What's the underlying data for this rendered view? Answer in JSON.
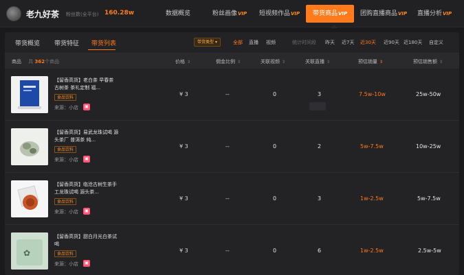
{
  "header": {
    "shop_name": "老九好茶",
    "fans_label": "粉丝数(全平台)",
    "fans_value": "160.28w",
    "nav": [
      {
        "label": "数据概览",
        "vip": ""
      },
      {
        "label": "粉丝画像",
        "vip": "VIP"
      },
      {
        "label": "短视频作品",
        "vip": "VIP"
      },
      {
        "label": "带货商品",
        "vip": "VIP"
      },
      {
        "label": "团购直播商品",
        "vip": "VIP"
      },
      {
        "label": "直播分析",
        "vip": "VIP"
      }
    ]
  },
  "subtabs": [
    "带货概览",
    "带货特征",
    "带货列表"
  ],
  "filters": {
    "type_label": "带货类型",
    "types": [
      "全部",
      "直播",
      "视频"
    ],
    "time_label": "统计时间段",
    "times": [
      "昨天",
      "近7天",
      "近30天",
      "近90天",
      "近180天",
      "自定义"
    ]
  },
  "table": {
    "product_label": "商品",
    "count_prefix": "共",
    "count": "362",
    "count_suffix": "个商品",
    "columns": [
      "价格",
      "佣金比例",
      "关联视频",
      "关联直播",
      "预估销量",
      "预估销售额"
    ],
    "rows": [
      {
        "title": "【留香高货】老白茶 早春茶 古树茶 茶礼定制 福...",
        "tag": "食品饮料",
        "source": "来源：小店",
        "price": "¥ 3",
        "commission": "--",
        "videos": "0",
        "lives": "3",
        "sales": "7.5w-10w",
        "revenue": "25w-50w"
      },
      {
        "title": "【留香高货】易武龙珠试喝 源头茶厂 普洱茶 纯...",
        "tag": "食品饮料",
        "source": "来源：小店",
        "price": "¥ 3",
        "commission": "--",
        "videos": "0",
        "lives": "2",
        "sales": "5w-7.5w",
        "revenue": "10w-25w"
      },
      {
        "title": "【留香高货】临沧古树生茶手工龙珠试喝 源头茶...",
        "tag": "食品饮料",
        "source": "来源：小店",
        "price": "¥ 3",
        "commission": "--",
        "videos": "0",
        "lives": "3",
        "sales": "1w-2.5w",
        "revenue": "5w-7.5w"
      },
      {
        "title": "【留香高货】甜白月光白茶试喝",
        "tag": "食品饮料",
        "source": "来源：小店",
        "price": "¥ 3",
        "commission": "--",
        "videos": "0",
        "lives": "6",
        "sales": "1w-2.5w",
        "revenue": "2.5w-5w"
      }
    ]
  },
  "colors": {
    "accent": "#ff7a1a",
    "background": "#1a1a1c",
    "panel": "#232326"
  }
}
